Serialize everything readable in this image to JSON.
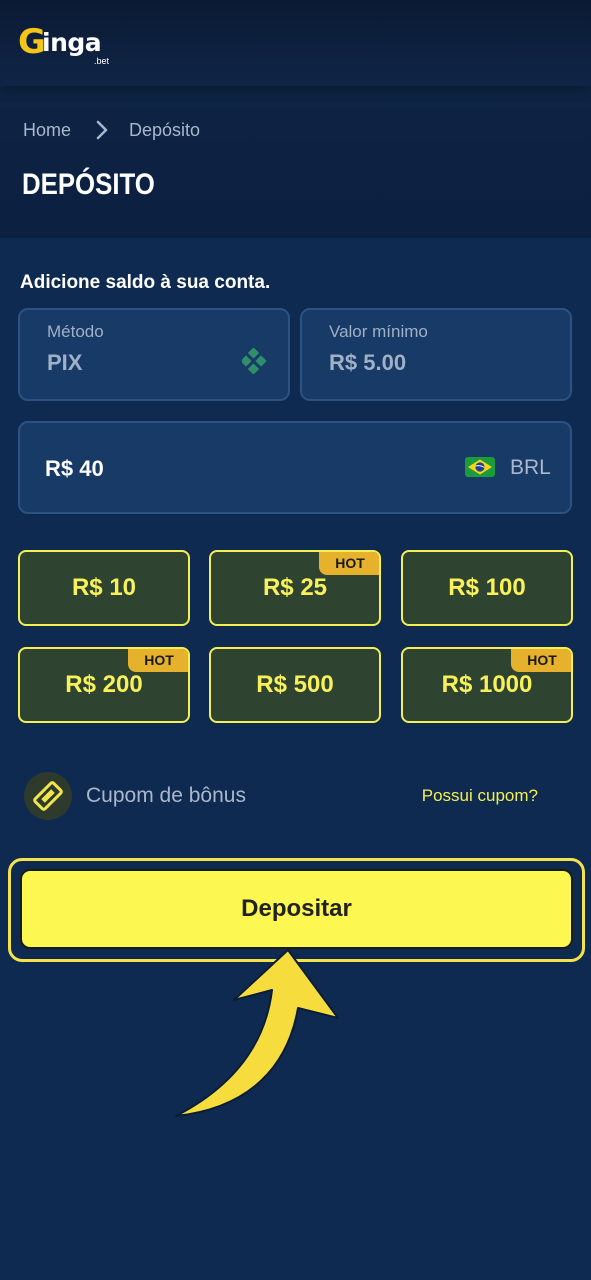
{
  "header": {
    "logo_main": "inga",
    "logo_initial": "G",
    "logo_sub": ".bet"
  },
  "breadcrumb": {
    "home": "Home",
    "current": "Depósito"
  },
  "page_title": "DEPÓSITO",
  "form": {
    "subtitle": "Adicione saldo à sua conta.",
    "method": {
      "label": "Método",
      "value": "PIX",
      "icon": "pix-icon"
    },
    "minimum": {
      "label": "Valor mínimo",
      "value": "R$ 5.00"
    },
    "amount": {
      "value": "R$ 40",
      "currency": "BRL",
      "flag_icon": "brazil-flag-icon"
    },
    "presets": [
      {
        "label": "R$ 10",
        "badge": ""
      },
      {
        "label": "R$ 25",
        "badge": "HOT"
      },
      {
        "label": "R$ 100",
        "badge": ""
      },
      {
        "label": "R$ 200",
        "badge": "HOT"
      },
      {
        "label": "R$ 500",
        "badge": ""
      },
      {
        "label": "R$ 1000",
        "badge": "HOT"
      }
    ],
    "coupon": {
      "label": "Cupom de bônus",
      "link": "Possui cupom?",
      "icon": "ticket-icon"
    },
    "submit_label": "Depositar"
  },
  "colors": {
    "background": "#0f2a50",
    "accent": "#fdf751",
    "chip_bg": "#2f4331",
    "hot_badge": "#e6b22e"
  }
}
